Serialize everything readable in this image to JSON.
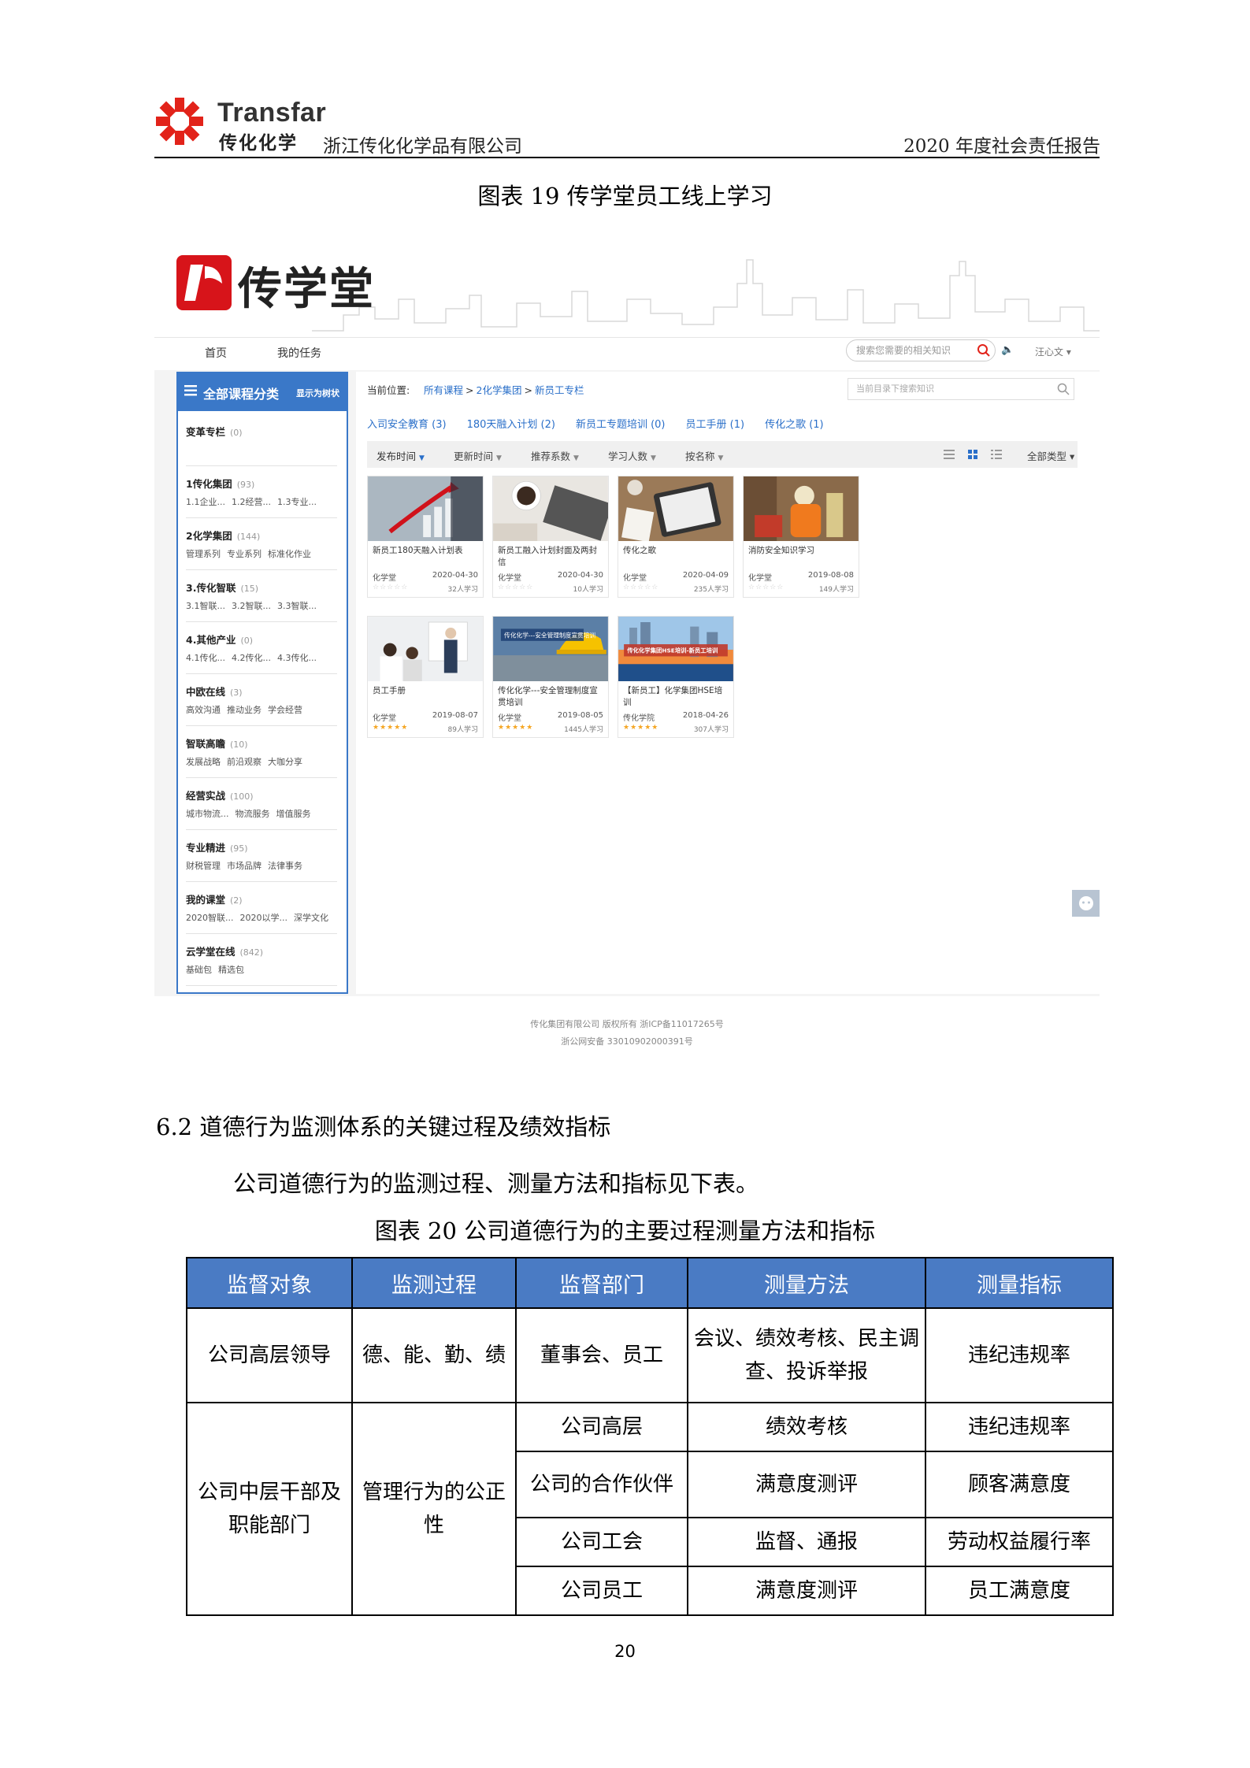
{
  "header": {
    "brand_en": "Transfar",
    "brand_cn": "传化化学",
    "company": "浙江传化化学品有限公司",
    "report_title": "2020 年度社会责任报告"
  },
  "figure19_caption": "图表 19  传学堂员工线上学习",
  "screenshot": {
    "banner_title": "传学堂",
    "nav": {
      "home": "首页",
      "tasks": "我的任务"
    },
    "search_placeholder": "搜索您需要的相关知识",
    "user_menu": "汪心文 ▾",
    "sidebar": {
      "title": "全部课程分类",
      "toggle": "显示为树状",
      "categories": [
        {
          "name": "变革专栏",
          "count": "(0)",
          "subs": []
        },
        {
          "name": "1传化集团",
          "count": "(93)",
          "subs": [
            "1.1企业...",
            "1.2经营...",
            "1.3专业..."
          ]
        },
        {
          "name": "2化学集团",
          "count": "(144)",
          "subs": [
            "管理系列",
            "专业系列",
            "标准化作业"
          ]
        },
        {
          "name": "3.传化智联",
          "count": "(15)",
          "subs": [
            "3.1智联...",
            "3.2智联...",
            "3.3智联..."
          ]
        },
        {
          "name": "4.其他产业",
          "count": "(0)",
          "subs": [
            "4.1传化...",
            "4.2传化...",
            "4.3传化..."
          ]
        },
        {
          "name": "中欧在线",
          "count": "(3)",
          "subs": [
            "高效沟通",
            "推动业务",
            "学会经营"
          ]
        },
        {
          "name": "智联高瞻",
          "count": "(10)",
          "subs": [
            "发展战略",
            "前沿观察",
            "大咖分享"
          ]
        },
        {
          "name": "经营实战",
          "count": "(100)",
          "subs": [
            "城市物流...",
            "物流服务",
            "增值服务"
          ]
        },
        {
          "name": "专业精进",
          "count": "(95)",
          "subs": [
            "财税管理",
            "市场品牌",
            "法律事务"
          ]
        },
        {
          "name": "我的课堂",
          "count": "(2)",
          "subs": [
            "2020智联...",
            "2020以学...",
            "深学文化"
          ]
        },
        {
          "name": "云学堂在线",
          "count": "(842)",
          "subs": [
            "基础包",
            "精选包"
          ]
        }
      ]
    },
    "breadcrumb": {
      "label": "当前位置:",
      "items": [
        "所有课程",
        "2化学集团",
        "新员工专栏"
      ]
    },
    "dir_search_placeholder": "当前目录下搜索知识",
    "tags": [
      "入司安全教育 (3)",
      "180天融入计划 (2)",
      "新员工专题培训 (0)",
      "员工手册 (1)",
      "传化之歌 (1)"
    ],
    "sort": [
      "发布时间",
      "更新时间",
      "推荐系数",
      "学习人数",
      "按名称"
    ],
    "type_filter": "全部类型 ▾",
    "courses": [
      {
        "title": "新员工180天融入计划表",
        "org": "化学堂",
        "date": "2020-04-30",
        "learners": "32人学习",
        "stars": "☆☆☆☆☆",
        "rated": false
      },
      {
        "title": "新员工融入计划封面及两封信",
        "org": "化学堂",
        "date": "2020-04-30",
        "learners": "10人学习",
        "stars": "☆☆☆☆☆",
        "rated": false
      },
      {
        "title": "传化之歌",
        "org": "化学堂",
        "date": "2020-04-09",
        "learners": "235人学习",
        "stars": "☆☆☆☆☆",
        "rated": false
      },
      {
        "title": "消防安全知识学习",
        "org": "化学堂",
        "date": "2019-08-08",
        "learners": "149人学习",
        "stars": "☆☆☆☆☆",
        "rated": false
      },
      {
        "title": "员工手册",
        "org": "化学堂",
        "date": "2019-08-07",
        "learners": "89人学习",
        "stars": "★★★★★",
        "rated": true
      },
      {
        "title": "传化化学---安全管理制度宣贯培训",
        "org": "化学堂",
        "date": "2019-08-05",
        "learners": "1445人学习",
        "stars": "★★★★★",
        "rated": true,
        "image_text": "传化化学---安全管理制度宣贯培训"
      },
      {
        "title": "【新员工】化学集团HSE培训",
        "org": "传化学院",
        "date": "2018-04-26",
        "learners": "307人学习",
        "stars": "★★★★★",
        "rated": true,
        "image_text": "传化化学集团HSE培训-新员工培训"
      }
    ],
    "footer_copyright": "传化集团有限公司 版权所有  浙ICP备11017265号",
    "footer_icp": "浙公网安备 33010902000391号"
  },
  "section_heading": "6.2 道德行为监测体系的关键过程及绩效指标",
  "paragraph": "公司道德行为的监测过程、测量方法和指标见下表。",
  "figure20_caption": "图表 20  公司道德行为的主要过程测量方法和指标",
  "table": {
    "headers": [
      "监督对象",
      "监测过程",
      "监督部门",
      "测量方法",
      "测量指标"
    ],
    "row1": {
      "object": "公司高层领导",
      "process": "德、能、勤、绩",
      "dept": "董事会、员工",
      "method": "会议、绩效考核、民主调查、投诉举报",
      "metric": "违纪违规率"
    },
    "group2": {
      "object": "公司中层干部及职能部门",
      "process": "管理行为的公正性",
      "rows": [
        {
          "dept": "公司高层",
          "method": "绩效考核",
          "metric": "违纪违规率"
        },
        {
          "dept": "公司的合作伙伴",
          "method": "满意度测评",
          "metric": "顾客满意度"
        },
        {
          "dept": "公司工会",
          "method": "监督、通报",
          "metric": "劳动权益履行率"
        },
        {
          "dept": "公司员工",
          "method": "满意度测评",
          "metric": "员工满意度"
        }
      ]
    }
  },
  "page_number": "20",
  "colors": {
    "brand_red": "#e2231a",
    "accent_blue": "#3a78c8",
    "table_header": "#4a7bc4",
    "star_gold": "#f5a623"
  }
}
